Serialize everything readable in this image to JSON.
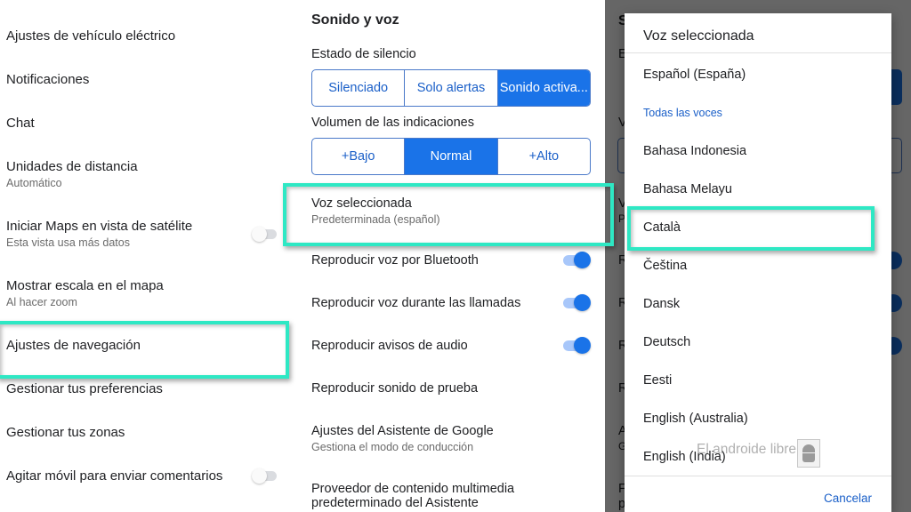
{
  "left_panel": {
    "items": [
      {
        "title": "Ajustes de vehículo eléctrico"
      },
      {
        "title": "Notificaciones"
      },
      {
        "title": "Chat"
      },
      {
        "title": "Unidades de distancia",
        "subtitle": "Automático"
      },
      {
        "title": "Iniciar Maps en vista de satélite",
        "subtitle": "Esta vista usa más datos",
        "toggle": "off"
      },
      {
        "title": "Mostrar escala en el mapa",
        "subtitle": "Al hacer zoom"
      },
      {
        "title": "Ajustes de navegación",
        "highlighted": true
      },
      {
        "title": "Gestionar tus preferencias"
      },
      {
        "title": "Gestionar tus zonas"
      },
      {
        "title": "Agitar móvil para enviar comentarios",
        "toggle": "off"
      }
    ]
  },
  "middle_panel": {
    "section_title": "Sonido y voz",
    "mute_state": {
      "label": "Estado de silencio",
      "options": [
        "Silenciado",
        "Solo alertas",
        "Sonido activa..."
      ],
      "selected": "Sonido activa..."
    },
    "volume": {
      "label": "Volumen de las indicaciones",
      "options": [
        "+Bajo",
        "Normal",
        "+Alto"
      ],
      "selected": "Normal"
    },
    "items": [
      {
        "title": "Voz seleccionada",
        "subtitle": "Predeterminada (español)",
        "highlighted": true
      },
      {
        "title": "Reproducir voz por Bluetooth",
        "toggle": "on"
      },
      {
        "title": "Reproducir voz durante las llamadas",
        "toggle": "on"
      },
      {
        "title": "Reproducir avisos de audio",
        "toggle": "on"
      },
      {
        "title": "Reproducir sonido de prueba"
      },
      {
        "title": "Ajustes del Asistente de Google",
        "subtitle": "Gestiona el modo de conducción"
      },
      {
        "title": "Proveedor de contenido multimedia",
        "title_line2": "predeterminado del Asistente"
      }
    ]
  },
  "background_ghost": {
    "letters": [
      "S",
      "E",
      "V",
      "V",
      "P",
      "R",
      "R",
      "R",
      "R",
      "A",
      "G",
      "F",
      "p"
    ]
  },
  "dialog": {
    "title": "Voz seleccionada",
    "current": "Español (España)",
    "all_voices_header": "Todas las voces",
    "voices": [
      "Bahasa Indonesia",
      "Bahasa Melayu",
      "Català",
      "Čeština",
      "Dansk",
      "Deutsch",
      "Eesti",
      "English (Australia)",
      "English (India)"
    ],
    "highlighted_voice": "Català",
    "cancel_label": "Cancelar"
  },
  "watermark": {
    "text": "El androide libre"
  },
  "colors": {
    "accent": "#1a73e8",
    "highlight_frame": "#2ee8c4",
    "link_blue": "#1a5fc8"
  }
}
